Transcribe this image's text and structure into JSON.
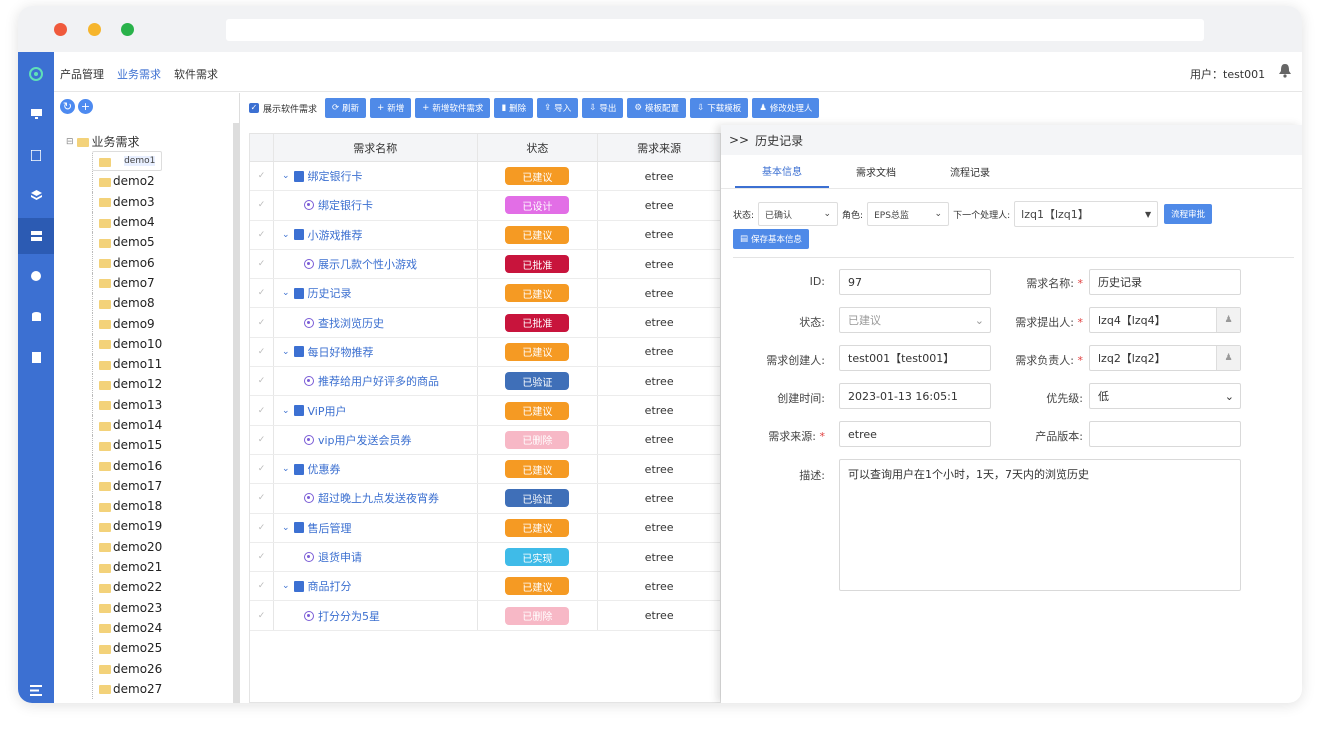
{
  "topnav": {
    "items": [
      "产品管理",
      "业务需求",
      "软件需求"
    ],
    "user": "用户：test001"
  },
  "tree": {
    "root": "业务需求",
    "items": [
      "demo1",
      "demo2",
      "demo3",
      "demo4",
      "demo5",
      "demo6",
      "demo7",
      "demo8",
      "demo9",
      "demo10",
      "demo11",
      "demo12",
      "demo13",
      "demo14",
      "demo15",
      "demo16",
      "demo17",
      "demo18",
      "demo19",
      "demo20",
      "demo21",
      "demo22",
      "demo23",
      "demo24",
      "demo25",
      "demo26",
      "demo27"
    ]
  },
  "toolbar": {
    "show_software": "展示软件需求",
    "buttons": [
      "刷新",
      "新增",
      "新增软件需求",
      "删除",
      "导入",
      "导出",
      "模板配置",
      "下载模板",
      "修改处理人"
    ]
  },
  "grid": {
    "headers": [
      "需求名称",
      "状态",
      "需求来源"
    ],
    "rows": [
      {
        "name": "绑定银行卡",
        "status": "已建议",
        "source": "etree",
        "level": "parent",
        "color": "#f59a23"
      },
      {
        "name": "绑定银行卡",
        "status": "已设计",
        "source": "etree",
        "level": "child",
        "color": "#e26ee6"
      },
      {
        "name": "小游戏推荐",
        "status": "已建议",
        "source": "etree",
        "level": "parent",
        "color": "#f59a23"
      },
      {
        "name": "展示几款个性小游戏",
        "status": "已批准",
        "source": "etree",
        "level": "child",
        "color": "#c8143c"
      },
      {
        "name": "历史记录",
        "status": "已建议",
        "source": "etree",
        "level": "parent",
        "color": "#f59a23"
      },
      {
        "name": "查找浏览历史",
        "status": "已批准",
        "source": "etree",
        "level": "child",
        "color": "#c8143c"
      },
      {
        "name": "每日好物推荐",
        "status": "已建议",
        "source": "etree",
        "level": "parent",
        "color": "#f59a23"
      },
      {
        "name": "推荐给用户好评多的商品",
        "status": "已验证",
        "source": "etree",
        "level": "child",
        "color": "#3f6fb8"
      },
      {
        "name": "ViP用户",
        "status": "已建议",
        "source": "etree",
        "level": "parent",
        "color": "#f59a23"
      },
      {
        "name": "vip用户发送会员券",
        "status": "已删除",
        "source": "etree",
        "level": "child",
        "color": "#f7b8c6"
      },
      {
        "name": "优惠券",
        "status": "已建议",
        "source": "etree",
        "level": "parent",
        "color": "#f59a23"
      },
      {
        "name": "超过晚上九点发送夜宵券",
        "status": "已验证",
        "source": "etree",
        "level": "child",
        "color": "#3f6fb8"
      },
      {
        "name": "售后管理",
        "status": "已建议",
        "source": "etree",
        "level": "parent",
        "color": "#f59a23"
      },
      {
        "name": "退货申请",
        "status": "已实现",
        "source": "etree",
        "level": "child",
        "color": "#3fbbe8"
      },
      {
        "name": "商品打分",
        "status": "已建议",
        "source": "etree",
        "level": "parent",
        "color": "#f59a23"
      },
      {
        "name": "打分分为5星",
        "status": "已删除",
        "source": "etree",
        "level": "child",
        "color": "#f7b8c6"
      }
    ]
  },
  "panel": {
    "arrow": ">>",
    "title": "历史记录",
    "tabs": [
      "基本信息",
      "需求文档",
      "流程记录"
    ],
    "ctrl": {
      "status_label": "状态:",
      "status_value": "已确认",
      "role_label": "角色:",
      "role_value": "EPS总监",
      "next_label": "下一个处理人:",
      "next_value": "lzq1【lzq1】",
      "approve": "流程审批",
      "save": "保存基本信息"
    },
    "form": {
      "id_label": "ID:",
      "id_value": "97",
      "name_label": "需求名称:",
      "name_value": "历史记录",
      "status_label": "状态:",
      "status_value": "已建议",
      "proposer_label": "需求提出人:",
      "proposer_value": "lzq4【lzq4】",
      "creator_label": "需求创建人:",
      "creator_value": "test001【test001】",
      "owner_label": "需求负责人:",
      "owner_value": "lzq2【lzq2】",
      "created_label": "创建时间:",
      "created_value": "2023-01-13 16:05:1",
      "priority_label": "优先级:",
      "priority_value": "低",
      "source_label": "需求来源:",
      "source_value": "etree",
      "version_label": "产品版本:",
      "version_value": "",
      "desc_label": "描述:",
      "desc_value": "可以查询用户在1个小时，1天，7天内的浏览历史"
    }
  }
}
